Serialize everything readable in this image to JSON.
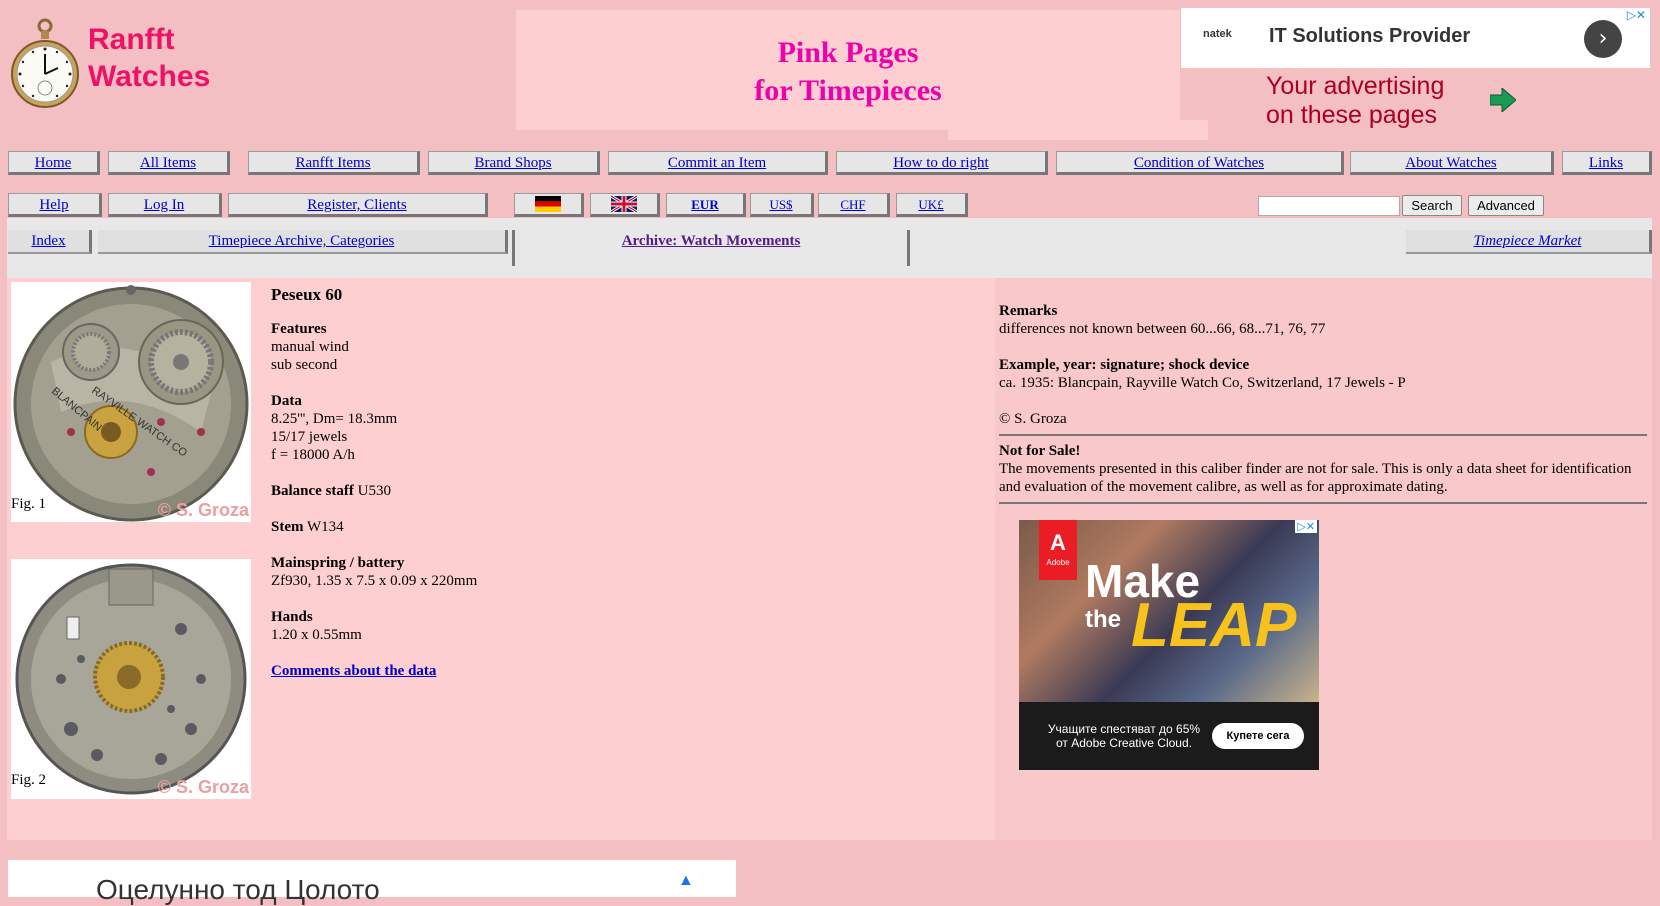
{
  "header": {
    "logo_line1": "Ranfft",
    "logo_line2": "Watches",
    "banner_line1": "Pink Pages",
    "banner_line2": "for Timepieces",
    "advert_line1": "Your advertising",
    "advert_line2": "on these pages"
  },
  "top_ad": {
    "brand": "natek",
    "title": "IT Solutions Provider"
  },
  "nav1": [
    "Home",
    "All Items",
    "Ranfft Items",
    "Brand Shops",
    "Commit an Item",
    "How to do right",
    "Condition of Watches",
    "About Watches",
    "Links"
  ],
  "nav2": [
    "Help",
    "Log In",
    "Register, Clients"
  ],
  "currencies": [
    "EUR",
    "US$",
    "CHF",
    "UK£"
  ],
  "search": {
    "button": "Search",
    "advanced": "Advanced"
  },
  "nav3": {
    "index": "Index",
    "archive": "Timepiece Archive, Categories",
    "active": "Archive: Watch Movements",
    "market": "Timepiece Market"
  },
  "figures": {
    "fig1": "Fig. 1",
    "fig2": "Fig. 2",
    "copyright": "© S. Groza"
  },
  "caliber": {
    "title": "Peseux 60",
    "features_h": "Features",
    "features": [
      "manual wind",
      "sub second"
    ],
    "data_h": "Data",
    "data": [
      "8.25''', Dm= 18.3mm",
      "15/17 jewels",
      "f = 18000 A/h"
    ],
    "balance_h": "Balance staff",
    "balance": "U530",
    "stem_h": "Stem",
    "stem": "W134",
    "mainspring_h": "Mainspring / battery",
    "mainspring": "Zf930, 1.35 x 7.5 x 0.09 x 220mm",
    "hands_h": "Hands",
    "hands": "1.20 x 0.55mm",
    "comments_link": "Comments about the data"
  },
  "remarks": {
    "remarks_h": "Remarks",
    "remarks": "differences not known between 60...66, 68...71, 76, 77",
    "example_h": "Example, year: signature; shock device",
    "example": "ca. 1935: Blancpain, Rayville Watch Co, Switzerland, 17 Jewels - P",
    "copyright": "© S. Groza",
    "notsale_h": "Not for Sale!",
    "notsale": "The movements presented in this caliber finder are not for sale. This is only a data sheet for identification and evaluation of the movement calibre, as well as for approximate dating."
  },
  "adobe_ad": {
    "logo": "Adobe",
    "make": "Make",
    "the": "the",
    "leap": "LEAP",
    "offer_line1": "Учащите спестяват до 65%",
    "offer_line2": "от Adobe Creative Cloud.",
    "cta": "Купете сега"
  },
  "bottom_ad": {
    "text": "Оцелунно тод Цолото"
  },
  "colors": {
    "page_bg": "#f4bfc2",
    "logo": "#ee1166",
    "banner_title": "#ee00aa",
    "advert": "#aa0022",
    "link": "#0000cc"
  }
}
